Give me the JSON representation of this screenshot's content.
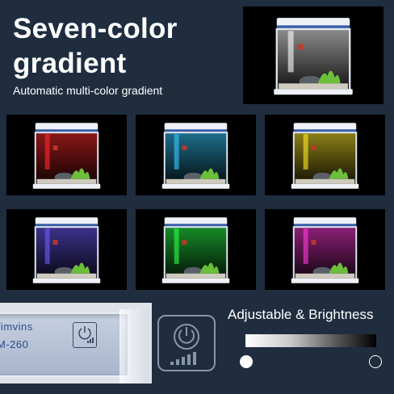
{
  "headline": "Seven-color\ngradient",
  "subline": "Automatic multi-color gradient",
  "tiles": [
    {
      "light": "#ff2a2a"
    },
    {
      "light": "#38c8ff"
    },
    {
      "light": "#ffe82a"
    },
    {
      "light": "#6f5bff"
    },
    {
      "light": "#2aff4a"
    },
    {
      "light": "#ff3ad8"
    }
  ],
  "hero": {
    "light": "#ffffff"
  },
  "device": {
    "brand": "Vimvins",
    "model": "M-260"
  },
  "brightness": {
    "title": "Adjustable & Brightness"
  },
  "icons": {
    "power": "power-icon",
    "signal": "signal-bars-icon"
  }
}
